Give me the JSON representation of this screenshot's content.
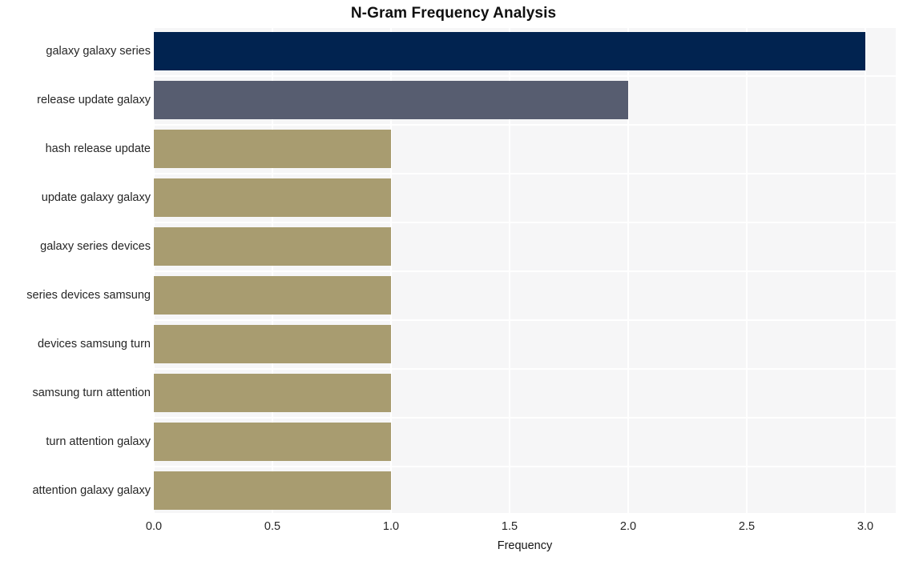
{
  "chart_data": {
    "type": "bar",
    "orientation": "horizontal",
    "title": "N-Gram Frequency Analysis",
    "xlabel": "Frequency",
    "ylabel": "",
    "xlim": [
      0,
      3.15
    ],
    "xticks": [
      0.0,
      0.5,
      1.0,
      1.5,
      2.0,
      2.5,
      3.0
    ],
    "xticklabels": [
      "0.0",
      "0.5",
      "1.0",
      "1.5",
      "2.0",
      "2.5",
      "3.0"
    ],
    "grid": true,
    "legend": "none",
    "categories": [
      "galaxy galaxy series",
      "release update galaxy",
      "hash release update",
      "update galaxy galaxy",
      "galaxy series devices",
      "series devices samsung",
      "devices samsung turn",
      "samsung turn attention",
      "turn attention galaxy",
      "attention galaxy galaxy"
    ],
    "values": [
      3,
      2,
      1,
      1,
      1,
      1,
      1,
      1,
      1,
      1
    ],
    "bar_colors": [
      "#012350",
      "#575d70",
      "#a89c70",
      "#a89c70",
      "#a89c70",
      "#a89c70",
      "#a89c70",
      "#a89c70",
      "#a89c70",
      "#a89c70"
    ]
  },
  "style": {
    "plot_background": "#f6f6f7",
    "grid_color": "#ffffff",
    "figure_background": "#ffffff",
    "text_color": "#262626"
  }
}
